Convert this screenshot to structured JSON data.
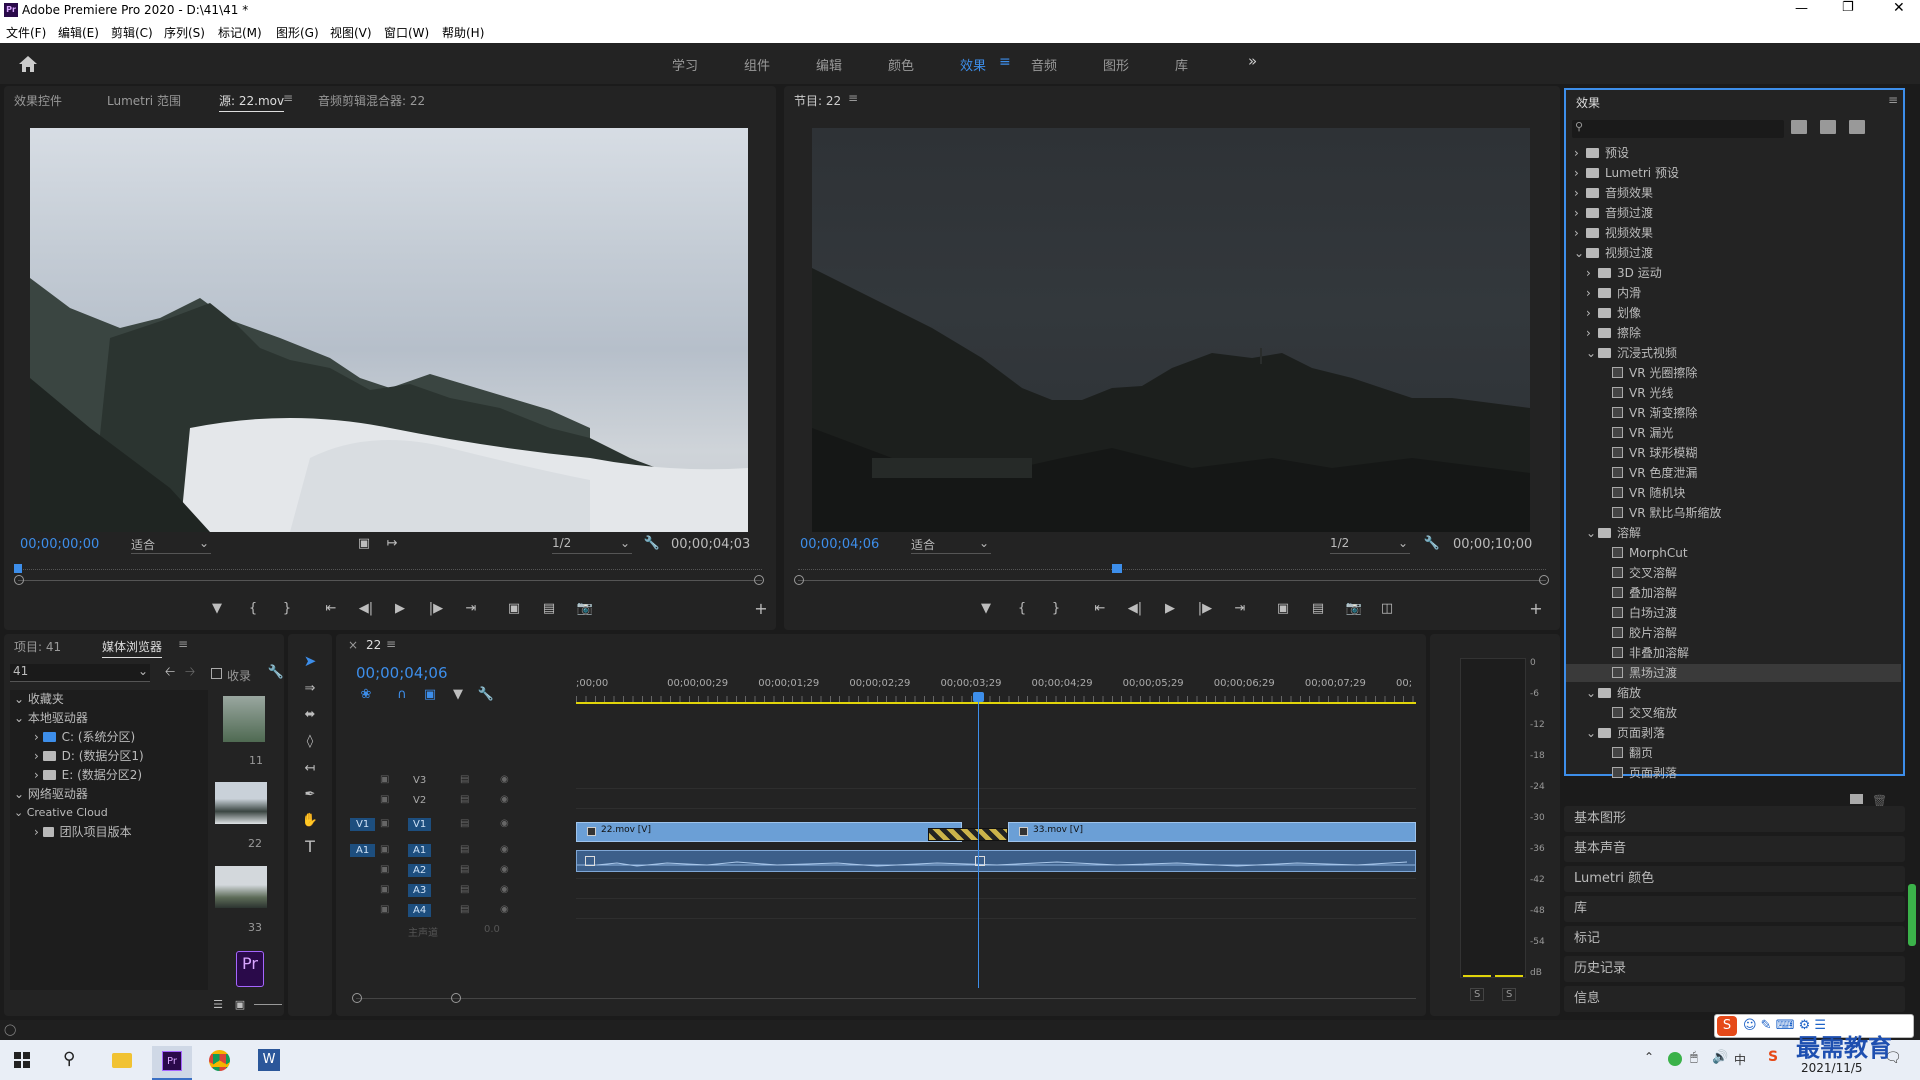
{
  "title": "Adobe Premiere Pro 2020 - D:\\41\\41 *",
  "menu": [
    "文件(F)",
    "编辑(E)",
    "剪辑(C)",
    "序列(S)",
    "标记(M)",
    "图形(G)",
    "视图(V)",
    "窗口(W)",
    "帮助(H)"
  ],
  "workspaces": [
    "学习",
    "组件",
    "编辑",
    "颜色",
    "效果",
    "音频",
    "图形",
    "库"
  ],
  "active_workspace": "效果",
  "source": {
    "tabs": [
      "效果控件",
      "Lumetri 范围",
      "源: 22.mov",
      "音频剪辑混合器: 22"
    ],
    "timecode": "00;00;00;00",
    "fit": "适合",
    "res": "1/2",
    "duration": "00;00;04;03"
  },
  "program": {
    "title": "节目: 22",
    "timecode": "00;00;04;06",
    "fit": "适合",
    "res": "1/2",
    "duration": "00;00;10;00",
    "playhead_fraction": 0.42
  },
  "effects": {
    "title": "效果",
    "tree": [
      {
        "label": "预设",
        "kind": "folder",
        "depth": 0
      },
      {
        "label": "Lumetri 预设",
        "kind": "folder",
        "depth": 0
      },
      {
        "label": "音频效果",
        "kind": "folder",
        "depth": 0
      },
      {
        "label": "音频过渡",
        "kind": "folder",
        "depth": 0
      },
      {
        "label": "视频效果",
        "kind": "folder",
        "depth": 0
      },
      {
        "label": "视频过渡",
        "kind": "folder",
        "depth": 0,
        "open": true
      },
      {
        "label": "3D 运动",
        "kind": "folder",
        "depth": 1
      },
      {
        "label": "内滑",
        "kind": "folder",
        "depth": 1
      },
      {
        "label": "划像",
        "kind": "folder",
        "depth": 1
      },
      {
        "label": "擦除",
        "kind": "folder",
        "depth": 1
      },
      {
        "label": "沉浸式视频",
        "kind": "folder",
        "depth": 1,
        "open": true
      },
      {
        "label": "VR 光圈擦除",
        "kind": "fx",
        "depth": 2
      },
      {
        "label": "VR 光线",
        "kind": "fx",
        "depth": 2
      },
      {
        "label": "VR 渐变擦除",
        "kind": "fx",
        "depth": 2
      },
      {
        "label": "VR 漏光",
        "kind": "fx",
        "depth": 2
      },
      {
        "label": "VR 球形模糊",
        "kind": "fx",
        "depth": 2
      },
      {
        "label": "VR 色度泄漏",
        "kind": "fx",
        "depth": 2
      },
      {
        "label": "VR 随机块",
        "kind": "fx",
        "depth": 2
      },
      {
        "label": "VR 默比乌斯缩放",
        "kind": "fx",
        "depth": 2
      },
      {
        "label": "溶解",
        "kind": "folder",
        "depth": 1,
        "open": true
      },
      {
        "label": "MorphCut",
        "kind": "fx",
        "depth": 2
      },
      {
        "label": "交叉溶解",
        "kind": "fx",
        "depth": 2
      },
      {
        "label": "叠加溶解",
        "kind": "fx",
        "depth": 2
      },
      {
        "label": "白场过渡",
        "kind": "fx",
        "depth": 2
      },
      {
        "label": "胶片溶解",
        "kind": "fx",
        "depth": 2
      },
      {
        "label": "非叠加溶解",
        "kind": "fx",
        "depth": 2
      },
      {
        "label": "黑场过渡",
        "kind": "fx",
        "depth": 2,
        "selected": true
      },
      {
        "label": "缩放",
        "kind": "folder",
        "depth": 1,
        "open": true
      },
      {
        "label": "交叉缩放",
        "kind": "fx",
        "depth": 2
      },
      {
        "label": "页面剥落",
        "kind": "folder",
        "depth": 1,
        "open": true
      },
      {
        "label": "翻页",
        "kind": "fx",
        "depth": 2
      },
      {
        "label": "页面剥落",
        "kind": "fx",
        "depth": 2
      }
    ],
    "panels": [
      "基本图形",
      "基本声音",
      "Lumetri 颜色",
      "库",
      "标记",
      "历史记录",
      "信息"
    ]
  },
  "project": {
    "tabs": [
      "项目: 41",
      "媒体浏览器"
    ],
    "path": "41",
    "ingest": "收录",
    "tree": [
      "收藏夹",
      "本地驱动器",
      "C: (系统分区)",
      "D: (数据分区1)",
      "E: (数据分区2)",
      "网络驱动器",
      "Creative Cloud",
      "团队项目版本"
    ],
    "thumbs": [
      "11",
      "22",
      "33"
    ]
  },
  "timeline": {
    "tab": "22",
    "timecode": "00;00;04;06",
    "ruler": [
      ";00;00",
      "00;00;00;29",
      "00;00;01;29",
      "00;00;02;29",
      "00;00;03;29",
      "00;00;04;29",
      "00;00;05;29",
      "00;00;06;29",
      "00;00;07;29",
      "00;"
    ],
    "video_tracks": [
      "V3",
      "V2",
      "V1"
    ],
    "audio_tracks": [
      "A1",
      "A2",
      "A3",
      "A4"
    ],
    "master": "主声道",
    "master_val": "0.0",
    "clips": [
      {
        "name": "22.mov [V]"
      },
      {
        "name": "33.mov [V]"
      }
    ]
  },
  "meter": {
    "scale": [
      "0",
      "-6",
      "-12",
      "-18",
      "-24",
      "-30",
      "-36",
      "-42",
      "-48",
      "-54",
      "dB"
    ],
    "solo": [
      "S",
      "S"
    ]
  },
  "taskbar": {
    "date": "2021/11/5",
    "ime": "中",
    "watermark": "最需教育"
  }
}
